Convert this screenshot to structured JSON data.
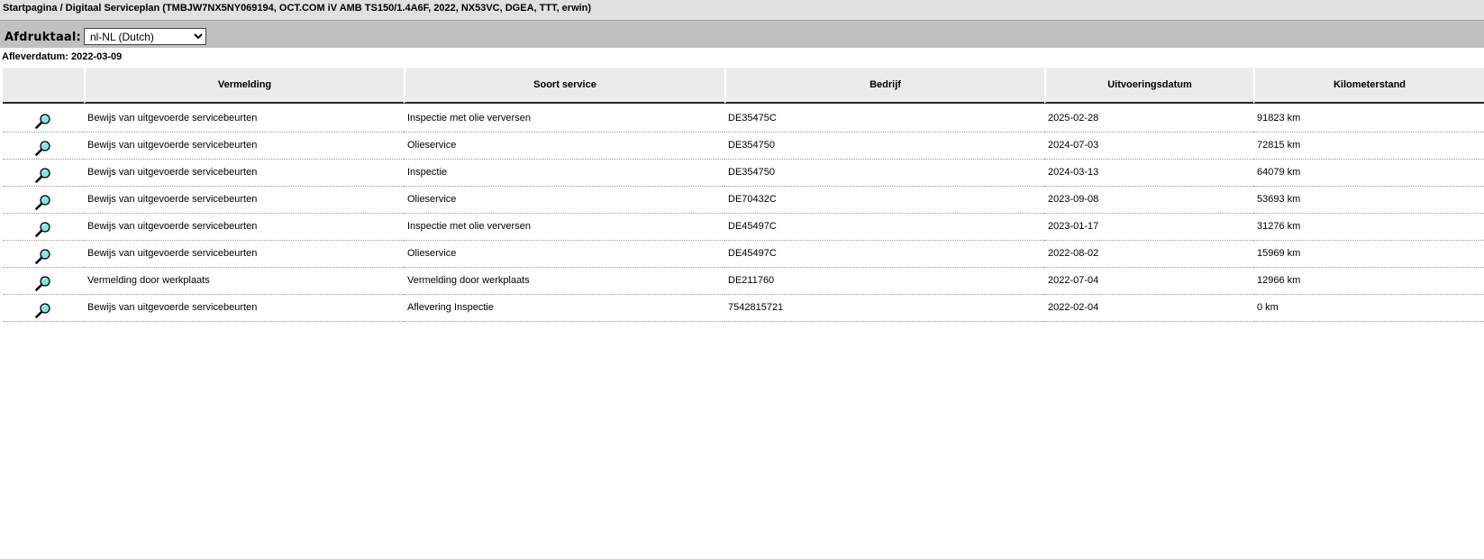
{
  "header": {
    "breadcrumb": "Startpagina / Digitaal Serviceplan (TMBJW7NX5NY069194, OCT.COM iV AMB TS150/1.4A6F, 2022, NX53VC, DGEA, TTT, erwin)"
  },
  "language": {
    "label": "Afdruktaal:",
    "selected": "nl-NL (Dutch)"
  },
  "delivery": {
    "text": "Afleverdatum: 2022-03-09"
  },
  "table": {
    "columns": [
      "",
      "Vermelding",
      "Soort service",
      "Bedrijf",
      "Uitvoeringsdatum",
      "Kilometerstand"
    ],
    "rows": [
      {
        "vermelding": "Bewijs van uitgevoerde servicebeurten",
        "soort": "Inspectie met olie verversen",
        "bedrijf": "DE35475C",
        "datum": "2025-02-28",
        "km": "91823 km"
      },
      {
        "vermelding": "Bewijs van uitgevoerde servicebeurten",
        "soort": "Olieservice",
        "bedrijf": "DE354750",
        "datum": "2024-07-03",
        "km": "72815 km"
      },
      {
        "vermelding": "Bewijs van uitgevoerde servicebeurten",
        "soort": "Inspectie",
        "bedrijf": "DE354750",
        "datum": "2024-03-13",
        "km": "64079 km"
      },
      {
        "vermelding": "Bewijs van uitgevoerde servicebeurten",
        "soort": "Olieservice",
        "bedrijf": "DE70432C",
        "datum": "2023-09-08",
        "km": "53693 km"
      },
      {
        "vermelding": "Bewijs van uitgevoerde servicebeurten",
        "soort": "Inspectie met olie verversen",
        "bedrijf": "DE45497C",
        "datum": "2023-01-17",
        "km": "31276 km"
      },
      {
        "vermelding": "Bewijs van uitgevoerde servicebeurten",
        "soort": "Olieservice",
        "bedrijf": "DE45497C",
        "datum": "2022-08-02",
        "km": "15969 km"
      },
      {
        "vermelding": "Vermelding door werkplaats",
        "soort": "Vermelding door werkplaats",
        "bedrijf": "DE211760",
        "datum": "2022-07-04",
        "km": "12966 km"
      },
      {
        "vermelding": "Bewijs van uitgevoerde servicebeurten",
        "soort": "Aflevering Inspectie",
        "bedrijf": "7542815721",
        "datum": "2022-02-04",
        "km": "0 km"
      }
    ],
    "row_icon": "magnifier-icon"
  },
  "colors": {
    "titlebar_bg": "#e0e0e0",
    "langbar_bg": "#c0c0c0",
    "header_bg": "#ebebeb",
    "magnifier_lens": "#7fe3ec"
  }
}
